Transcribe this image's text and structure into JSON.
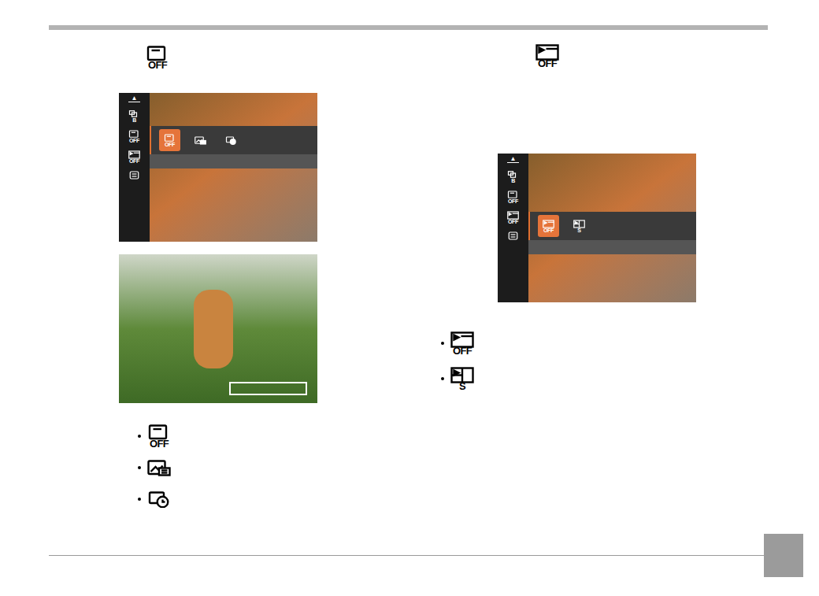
{
  "left": {
    "title_icon": {
      "kind": "stamp-off",
      "label": "OFF"
    },
    "screen": {
      "arrow": "▲",
      "sidebar": [
        {
          "kind": "bracket",
          "label": "B"
        },
        {
          "kind": "stamp-off",
          "label": "OFF"
        },
        {
          "kind": "review-off",
          "label": "OFF"
        },
        {
          "kind": "list"
        }
      ],
      "options": [
        {
          "kind": "stamp-off",
          "label": "OFF",
          "selected": true
        },
        {
          "kind": "stamp-date",
          "selected": false
        },
        {
          "kind": "stamp-clock",
          "selected": false
        }
      ]
    },
    "bullets": [
      {
        "kind": "stamp-off",
        "label": "OFF"
      },
      {
        "kind": "stamp-date"
      },
      {
        "kind": "stamp-clock"
      }
    ]
  },
  "right": {
    "title_icon": {
      "kind": "review-off",
      "label": "OFF"
    },
    "screen": {
      "arrow": "▲",
      "sidebar": [
        {
          "kind": "bracket",
          "label": "B"
        },
        {
          "kind": "stamp-off",
          "label": "OFF"
        },
        {
          "kind": "review-off",
          "label": "OFF"
        },
        {
          "kind": "list"
        }
      ],
      "options": [
        {
          "kind": "review-off",
          "label": "OFF",
          "selected": true
        },
        {
          "kind": "review-1s",
          "label": "S",
          "selected": false
        }
      ]
    },
    "bullets": [
      {
        "kind": "review-off",
        "label": "OFF"
      },
      {
        "kind": "review-1s",
        "label": "S"
      }
    ]
  }
}
